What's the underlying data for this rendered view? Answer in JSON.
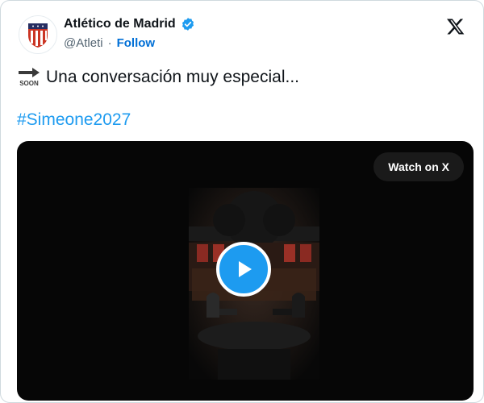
{
  "account": {
    "name": "Atlético de Madrid",
    "handle": "@Atleti",
    "separator": "·",
    "follow_label": "Follow"
  },
  "post": {
    "emoji": "soon-arrow-emoji",
    "text": "Una conversación muy especial...",
    "hashtag": "#Simeone2027"
  },
  "media": {
    "watch_label": "Watch on X",
    "play_icon": "play-icon"
  },
  "colors": {
    "accent": "#1d9bf0",
    "follow": "#006fd6",
    "text": "#0f1419",
    "muted": "#536471",
    "media_bg": "#060606"
  }
}
